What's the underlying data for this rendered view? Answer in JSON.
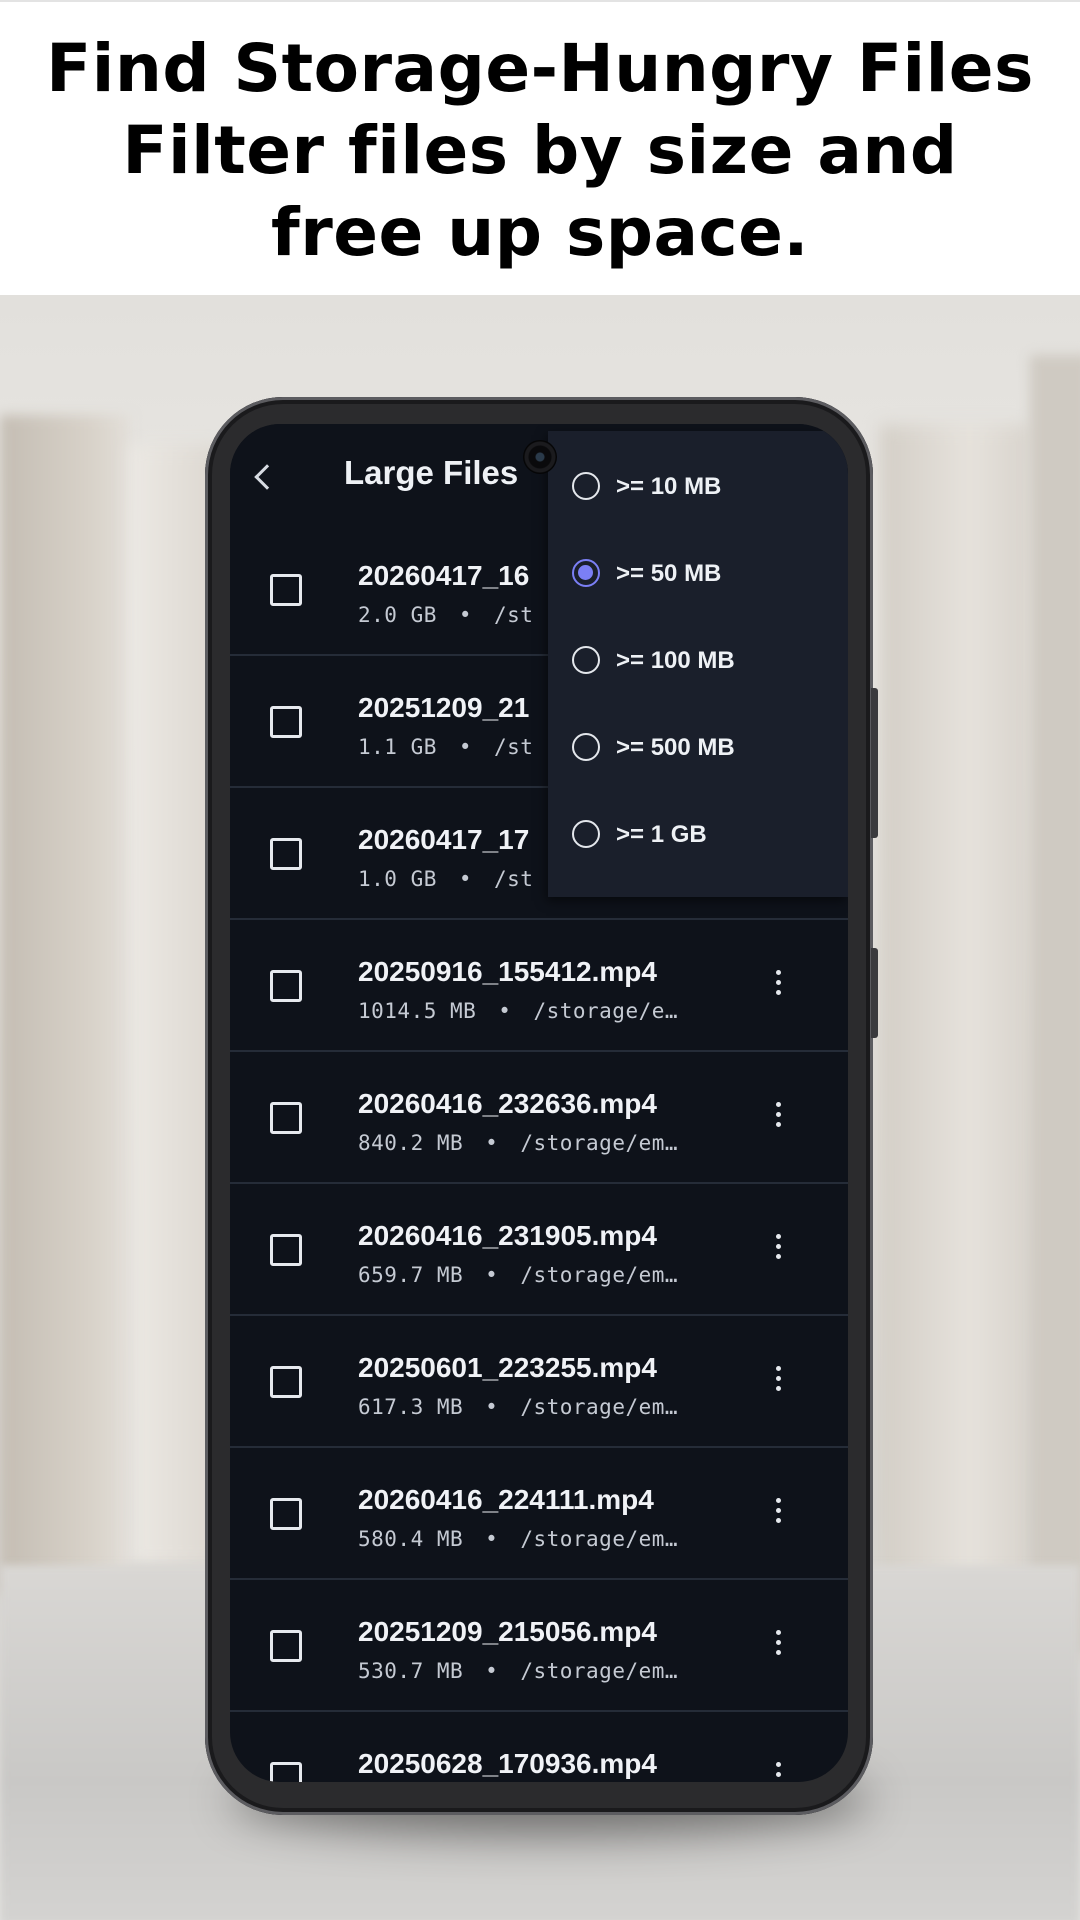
{
  "promo": {
    "line1": "Find Storage-Hungry Files",
    "line2": "Filter files by size and",
    "line3": "free up space."
  },
  "appbar": {
    "title": "Large Files"
  },
  "files": [
    {
      "name": "20260417_16",
      "size": "2.0 GB",
      "path": "/st"
    },
    {
      "name": "20251209_21",
      "size": "1.1 GB",
      "path": "/st"
    },
    {
      "name": "20260417_17",
      "size": "1.0 GB",
      "path": "/st"
    },
    {
      "name": "20250916_155412.mp4",
      "size": "1014.5 MB",
      "path": "/storage/e…"
    },
    {
      "name": "20260416_232636.mp4",
      "size": "840.2 MB",
      "path": "/storage/em…"
    },
    {
      "name": "20260416_231905.mp4",
      "size": "659.7 MB",
      "path": "/storage/em…"
    },
    {
      "name": "20250601_223255.mp4",
      "size": "617.3 MB",
      "path": "/storage/em…"
    },
    {
      "name": "20260416_224111.mp4",
      "size": "580.4 MB",
      "path": "/storage/em…"
    },
    {
      "name": "20251209_215056.mp4",
      "size": "530.7 MB",
      "path": "/storage/em…"
    },
    {
      "name": "20250628_170936.mp4",
      "size": "",
      "path": ""
    }
  ],
  "meta_separator": "•",
  "size_filter": {
    "selected": ">= 50 MB",
    "options": [
      ">= 10 MB",
      ">= 50 MB",
      ">= 100 MB",
      ">= 500 MB",
      ">= 1 GB"
    ]
  },
  "colors": {
    "screen_bg": "#0e121a",
    "menu_bg": "#1a1f2b",
    "accent": "#7b7ff5"
  }
}
